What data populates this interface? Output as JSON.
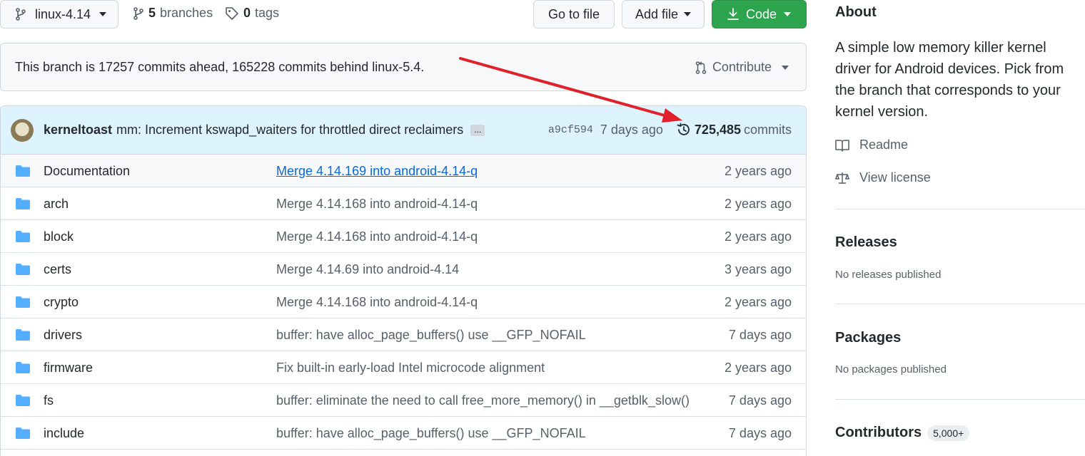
{
  "toolbar": {
    "branch": "linux-4.14",
    "branches_count": "5",
    "branches_label": "branches",
    "tags_count": "0",
    "tags_label": "tags",
    "go_to_file": "Go to file",
    "add_file": "Add file",
    "code": "Code"
  },
  "branch_status": {
    "text": "This branch is 17257 commits ahead, 165228 commits behind linux-5.4.",
    "contribute": "Contribute"
  },
  "latest_commit": {
    "author": "kerneltoast",
    "message": "mm: Increment kswapd_waiters for throttled direct reclaimers",
    "ellipsis": "...",
    "sha": "a9cf594",
    "age": "7 days ago",
    "commits_count": "725,485",
    "commits_label": "commits"
  },
  "files": [
    {
      "name": "Documentation",
      "message": "Merge 4.14.169 into android-4.14-q",
      "age": "2 years ago"
    },
    {
      "name": "arch",
      "message": "Merge 4.14.168 into android-4.14-q",
      "age": "2 years ago"
    },
    {
      "name": "block",
      "message": "Merge 4.14.168 into android-4.14-q",
      "age": "2 years ago"
    },
    {
      "name": "certs",
      "message": "Merge 4.14.69 into android-4.14",
      "age": "3 years ago"
    },
    {
      "name": "crypto",
      "message": "Merge 4.14.168 into android-4.14-q",
      "age": "2 years ago"
    },
    {
      "name": "drivers",
      "message": "buffer: have alloc_page_buffers() use __GFP_NOFAIL",
      "age": "7 days ago"
    },
    {
      "name": "firmware",
      "message": "Fix built-in early-load Intel microcode alignment",
      "age": "2 years ago"
    },
    {
      "name": "fs",
      "message": "buffer: eliminate the need to call free_more_memory() in __getblk_slow()",
      "age": "7 days ago"
    },
    {
      "name": "include",
      "message": "buffer: have alloc_page_buffers() use __GFP_NOFAIL",
      "age": "7 days ago"
    }
  ],
  "sidebar": {
    "about_title": "About",
    "about_desc": "A simple low memory killer kernel driver for Android devices. Pick from the branch that corresponds to your kernel version.",
    "readme": "Readme",
    "license": "View license",
    "releases_title": "Releases",
    "releases_sub": "No releases published",
    "packages_title": "Packages",
    "packages_sub": "No packages published",
    "contributors_title": "Contributors",
    "contributors_count": "5,000+"
  },
  "colors": {
    "code_button": "#2da44e",
    "commit_row_bg": "#ddf4ff",
    "folder": "#54aeff",
    "link": "#0969da",
    "annotation_arrow": "#e0212b"
  }
}
